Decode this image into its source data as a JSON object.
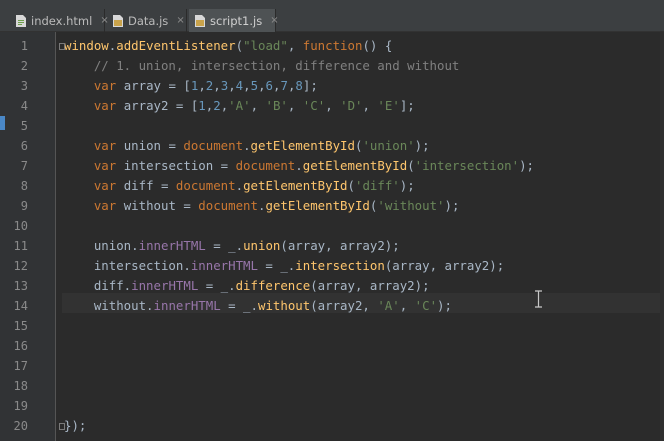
{
  "tabs": [
    {
      "label": "index.html",
      "icon": "html-file-icon",
      "close": "×",
      "active": false
    },
    {
      "label": "Data.js",
      "icon": "js-file-icon",
      "close": "×",
      "active": false
    },
    {
      "label": "script1.js",
      "icon": "js-file-icon",
      "close": "×",
      "active": true
    }
  ],
  "editor": {
    "line_numbers": [
      "1",
      "2",
      "3",
      "4",
      "5",
      "6",
      "7",
      "8",
      "9",
      "10",
      "11",
      "12",
      "13",
      "14",
      "15",
      "16",
      "17",
      "18",
      "19",
      "20"
    ],
    "current_line": "14",
    "lines": [
      [
        {
          "t": "fn",
          "v": "window"
        },
        {
          "t": "txt",
          "v": "."
        },
        {
          "t": "fn",
          "v": "addEventListener"
        },
        {
          "t": "txt",
          "v": "("
        },
        {
          "t": "str",
          "v": "\"load\""
        },
        {
          "t": "txt",
          "v": ", "
        },
        {
          "t": "kw",
          "v": "function"
        },
        {
          "t": "txt",
          "v": "() {"
        }
      ],
      [
        {
          "t": "com",
          "v": "    // 1. union, intersection, difference and without"
        }
      ],
      [
        {
          "t": "txt",
          "v": "    "
        },
        {
          "t": "kw",
          "v": "var"
        },
        {
          "t": "txt",
          "v": " array = ["
        },
        {
          "t": "num",
          "v": "1"
        },
        {
          "t": "txt",
          "v": ","
        },
        {
          "t": "num",
          "v": "2"
        },
        {
          "t": "txt",
          "v": ","
        },
        {
          "t": "num",
          "v": "3"
        },
        {
          "t": "txt",
          "v": ","
        },
        {
          "t": "num",
          "v": "4"
        },
        {
          "t": "txt",
          "v": ","
        },
        {
          "t": "num",
          "v": "5"
        },
        {
          "t": "txt",
          "v": ","
        },
        {
          "t": "num",
          "v": "6"
        },
        {
          "t": "txt",
          "v": ","
        },
        {
          "t": "num",
          "v": "7"
        },
        {
          "t": "txt",
          "v": ","
        },
        {
          "t": "num",
          "v": "8"
        },
        {
          "t": "txt",
          "v": "];"
        }
      ],
      [
        {
          "t": "txt",
          "v": "    "
        },
        {
          "t": "kw",
          "v": "var"
        },
        {
          "t": "txt",
          "v": " array2 = ["
        },
        {
          "t": "num",
          "v": "1"
        },
        {
          "t": "txt",
          "v": ","
        },
        {
          "t": "num",
          "v": "2"
        },
        {
          "t": "txt",
          "v": ","
        },
        {
          "t": "str",
          "v": "'A'"
        },
        {
          "t": "txt",
          "v": ", "
        },
        {
          "t": "str",
          "v": "'B'"
        },
        {
          "t": "txt",
          "v": ", "
        },
        {
          "t": "str",
          "v": "'C'"
        },
        {
          "t": "txt",
          "v": ", "
        },
        {
          "t": "str",
          "v": "'D'"
        },
        {
          "t": "txt",
          "v": ", "
        },
        {
          "t": "str",
          "v": "'E'"
        },
        {
          "t": "txt",
          "v": "];"
        }
      ],
      [],
      [
        {
          "t": "txt",
          "v": "    "
        },
        {
          "t": "kw",
          "v": "var"
        },
        {
          "t": "txt",
          "v": " union = "
        },
        {
          "t": "kw",
          "v": "document"
        },
        {
          "t": "txt",
          "v": "."
        },
        {
          "t": "fn",
          "v": "getElementById"
        },
        {
          "t": "txt",
          "v": "("
        },
        {
          "t": "str",
          "v": "'union'"
        },
        {
          "t": "txt",
          "v": ");"
        }
      ],
      [
        {
          "t": "txt",
          "v": "    "
        },
        {
          "t": "kw",
          "v": "var"
        },
        {
          "t": "txt",
          "v": " intersection = "
        },
        {
          "t": "kw",
          "v": "document"
        },
        {
          "t": "txt",
          "v": "."
        },
        {
          "t": "fn",
          "v": "getElementById"
        },
        {
          "t": "txt",
          "v": "("
        },
        {
          "t": "str",
          "v": "'intersection'"
        },
        {
          "t": "txt",
          "v": ");"
        }
      ],
      [
        {
          "t": "txt",
          "v": "    "
        },
        {
          "t": "kw",
          "v": "var"
        },
        {
          "t": "txt",
          "v": " diff = "
        },
        {
          "t": "kw",
          "v": "document"
        },
        {
          "t": "txt",
          "v": "."
        },
        {
          "t": "fn",
          "v": "getElementById"
        },
        {
          "t": "txt",
          "v": "("
        },
        {
          "t": "str",
          "v": "'diff'"
        },
        {
          "t": "txt",
          "v": ");"
        }
      ],
      [
        {
          "t": "txt",
          "v": "    "
        },
        {
          "t": "kw",
          "v": "var"
        },
        {
          "t": "txt",
          "v": " without = "
        },
        {
          "t": "kw",
          "v": "document"
        },
        {
          "t": "txt",
          "v": "."
        },
        {
          "t": "fn",
          "v": "getElementById"
        },
        {
          "t": "txt",
          "v": "("
        },
        {
          "t": "str",
          "v": "'without'"
        },
        {
          "t": "txt",
          "v": ");"
        }
      ],
      [],
      [
        {
          "t": "txt",
          "v": "    union."
        },
        {
          "t": "prop",
          "v": "innerHTML"
        },
        {
          "t": "txt",
          "v": " = _."
        },
        {
          "t": "fn",
          "v": "union"
        },
        {
          "t": "txt",
          "v": "(array, array2);"
        }
      ],
      [
        {
          "t": "txt",
          "v": "    intersection."
        },
        {
          "t": "prop",
          "v": "innerHTML"
        },
        {
          "t": "txt",
          "v": " = _."
        },
        {
          "t": "fn",
          "v": "intersection"
        },
        {
          "t": "txt",
          "v": "(array, array2);"
        }
      ],
      [
        {
          "t": "txt",
          "v": "    diff."
        },
        {
          "t": "prop",
          "v": "innerHTML"
        },
        {
          "t": "txt",
          "v": " = _."
        },
        {
          "t": "fn",
          "v": "difference"
        },
        {
          "t": "txt",
          "v": "(array, array2);"
        }
      ],
      [
        {
          "t": "txt",
          "v": "    without."
        },
        {
          "t": "prop",
          "v": "innerHTML"
        },
        {
          "t": "txt",
          "v": " = _."
        },
        {
          "t": "fn",
          "v": "without"
        },
        {
          "t": "txt",
          "v": "(array2, "
        },
        {
          "t": "str",
          "v": "'A'"
        },
        {
          "t": "txt",
          "v": ", "
        },
        {
          "t": "str",
          "v": "'C'"
        },
        {
          "t": "txt",
          "v": ");"
        }
      ],
      [],
      [],
      [],
      [],
      [],
      [
        {
          "t": "txt",
          "v": "});"
        }
      ]
    ]
  },
  "colors": {
    "keyword": "#cc7832",
    "function": "#ffc66d",
    "string": "#6a8759",
    "number": "#6897bb",
    "comment": "#808080",
    "property": "#9876aa",
    "text": "#a9b7c6",
    "background": "#2b2b2b"
  }
}
